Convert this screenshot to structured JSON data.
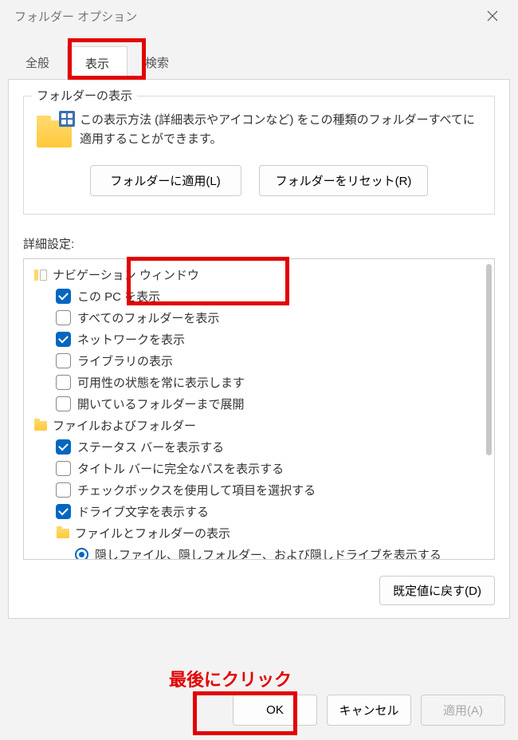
{
  "window": {
    "title": "フォルダー オプション"
  },
  "tabs": {
    "general": "全般",
    "view": "表示",
    "search": "検索"
  },
  "folderView": {
    "groupTitle": "フォルダーの表示",
    "description": "この表示方法 (詳細表示やアイコンなど) をこの種類のフォルダーすべてに適用することができます。",
    "applyButton": "フォルダーに適用(L)",
    "resetButton": "フォルダーをリセット(R)"
  },
  "details": {
    "label": "詳細設定:",
    "restoreDefaults": "既定値に戻す(D)"
  },
  "tree": [
    {
      "level": 1,
      "type": "nav-icon",
      "label": "ナビゲーション ウィンドウ"
    },
    {
      "level": 2,
      "type": "checkbox",
      "checked": true,
      "label": "この PC を表示"
    },
    {
      "level": 2,
      "type": "checkbox",
      "checked": false,
      "label": "すべてのフォルダーを表示"
    },
    {
      "level": 2,
      "type": "checkbox",
      "checked": true,
      "label": "ネットワークを表示"
    },
    {
      "level": 2,
      "type": "checkbox",
      "checked": false,
      "label": "ライブラリの表示"
    },
    {
      "level": 2,
      "type": "checkbox",
      "checked": false,
      "label": "可用性の状態を常に表示します"
    },
    {
      "level": 2,
      "type": "checkbox",
      "checked": false,
      "label": "開いているフォルダーまで展開"
    },
    {
      "level": 1,
      "type": "folder",
      "label": "ファイルおよびフォルダー"
    },
    {
      "level": 2,
      "type": "checkbox",
      "checked": true,
      "label": "ステータス バーを表示する"
    },
    {
      "level": 2,
      "type": "checkbox",
      "checked": false,
      "label": "タイトル バーに完全なパスを表示する"
    },
    {
      "level": 2,
      "type": "checkbox",
      "checked": false,
      "label": "チェックボックスを使用して項目を選択する"
    },
    {
      "level": 2,
      "type": "checkbox",
      "checked": true,
      "label": "ドライブ文字を表示する"
    },
    {
      "level": 2,
      "type": "folder",
      "label": "ファイルとフォルダーの表示"
    },
    {
      "level": 3,
      "type": "radio",
      "selected": true,
      "label": "隠しファイル、隠しフォルダー、および隠しドライブを表示する"
    }
  ],
  "dialog": {
    "ok": "OK",
    "cancel": "キャンセル",
    "apply": "適用(A)"
  },
  "annotation": {
    "text": "最後にクリック"
  }
}
